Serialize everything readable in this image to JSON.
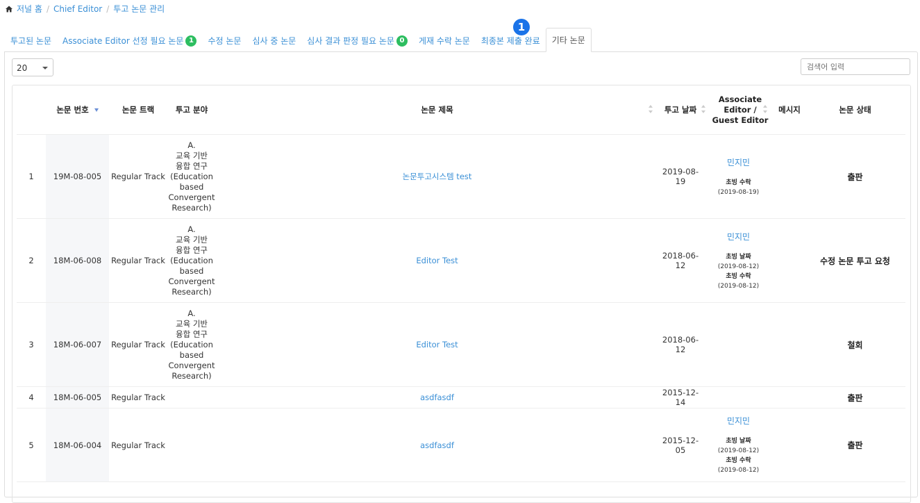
{
  "breadcrumb": {
    "home": "저널 홈",
    "level2": "Chief Editor",
    "level3": "투고 논문 관리"
  },
  "tabs": [
    {
      "label": "투고된 논문",
      "badge": null
    },
    {
      "label": "Associate Editor 선정 필요 논문",
      "badge": "1"
    },
    {
      "label": "수정 논문",
      "badge": null
    },
    {
      "label": "심사 중 논문",
      "badge": null
    },
    {
      "label": "심사 결과 판정 필요 논문",
      "badge": "0"
    },
    {
      "label": "게재 수락 논문",
      "badge": null
    },
    {
      "label": "최종본 제출 완료",
      "badge": null
    },
    {
      "label": "기타 논문",
      "badge": null
    }
  ],
  "step_marker": "1",
  "page_size": "20",
  "search_placeholder": "검색어 입력",
  "columns": {
    "no": "논문 번호",
    "track": "논문 트랙",
    "field": "투고 분야",
    "title": "논문 제목",
    "date": "투고 날짜",
    "editor_line1": "Associate",
    "editor_line2": "Editor /",
    "editor_line3": "Guest Editor",
    "message": "메시지",
    "status": "논문 상태"
  },
  "rows": [
    {
      "idx": "1",
      "no": "19M-08-005",
      "track": "Regular Track",
      "field": [
        "A.",
        "교육 기반",
        "융합 연구",
        "(Education",
        "based",
        "Convergent",
        "Research)"
      ],
      "title": "논문투고시스템 test",
      "date": "2019-08-19",
      "editor": "민지민",
      "events": [
        {
          "label": "초빙 수락",
          "date": "(2019-08-19)"
        }
      ],
      "status": "출판"
    },
    {
      "idx": "2",
      "no": "18M-06-008",
      "track": "Regular Track",
      "field": [
        "A.",
        "교육 기반",
        "융합 연구",
        "(Education",
        "based",
        "Convergent",
        "Research)"
      ],
      "title": "Editor Test",
      "date": "2018-06-12",
      "editor": "민지민",
      "events": [
        {
          "label": "초빙 날짜",
          "date": "(2019-08-12)"
        },
        {
          "label": "초빙 수락",
          "date": "(2019-08-12)"
        }
      ],
      "status": "수정 논문 투고 요청"
    },
    {
      "idx": "3",
      "no": "18M-06-007",
      "track": "Regular Track",
      "field": [
        "A.",
        "교육 기반",
        "융합 연구",
        "(Education",
        "based",
        "Convergent",
        "Research)"
      ],
      "title": "Editor Test",
      "date": "2018-06-12",
      "editor": "",
      "events": [],
      "status": "철회"
    },
    {
      "idx": "4",
      "no": "18M-06-005",
      "track": "Regular Track",
      "field": [],
      "title": "asdfasdf",
      "date": "2015-12-14",
      "editor": "",
      "events": [],
      "status": "출판"
    },
    {
      "idx": "5",
      "no": "18M-06-004",
      "track": "Regular Track",
      "field": [],
      "title": "asdfasdf",
      "date": "2015-12-05",
      "editor": "민지민",
      "events": [
        {
          "label": "초빙 날짜",
          "date": "(2019-08-12)"
        },
        {
          "label": "초빙 수락",
          "date": "(2019-08-12)"
        }
      ],
      "status": "출판"
    }
  ],
  "colors": {
    "link": "#3a8fd6",
    "badge": "#2dbe60",
    "marker": "#1a73e8"
  }
}
